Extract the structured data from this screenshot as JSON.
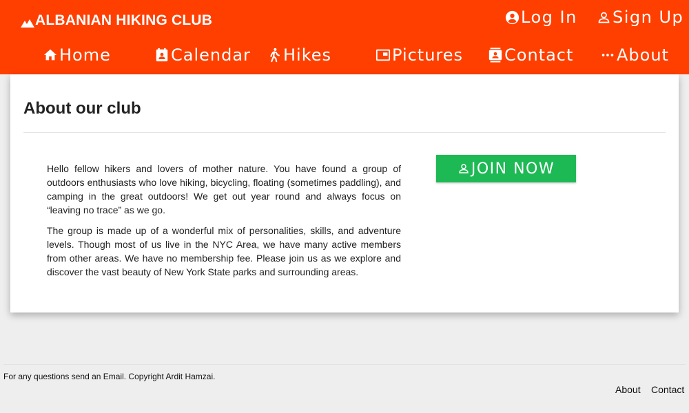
{
  "header": {
    "brand": "ALBANIAN HIKING CLUB",
    "brand_icon": "mountain-icon",
    "background_color": "#ff3f00",
    "auth": [
      {
        "label": "Log In",
        "icon": "account-circle-icon"
      },
      {
        "label": "Sign Up",
        "icon": "person-outline-icon"
      }
    ],
    "nav": [
      {
        "label": "Home",
        "icon": "home-icon"
      },
      {
        "label": "Calendar",
        "icon": "calendar-icon"
      },
      {
        "label": "Hikes",
        "icon": "walking-icon"
      },
      {
        "label": "Pictures",
        "icon": "pictures-icon"
      },
      {
        "label": "Contact",
        "icon": "contacts-icon"
      },
      {
        "label": "About",
        "icon": "more-horizontal-icon"
      }
    ]
  },
  "main": {
    "title": "About our club",
    "paragraphs": [
      "Hello fellow hikers and lovers of mother nature. You have found a group of outdoors enthusiasts who love hiking, bicycling, floating (sometimes paddling), and camping in the great outdoors! We get out year round and always focus on “leaving no trace” as we go.",
      "The group is made up of a wonderful mix of personalities, skills, and adventure levels. Though most of us live in the NYC Area, we have many active members from other areas. We have no membership fee. Please join us as we explore and discover the vast beauty of New York State parks and surrounding areas."
    ],
    "join_button": {
      "label": "JOIN NOW",
      "icon": "person-outline-icon",
      "color": "#1db954"
    }
  },
  "footer": {
    "text": "For any questions send an Email. Copyright Ardit Hamzai.",
    "links": [
      "About",
      "Contact"
    ]
  }
}
